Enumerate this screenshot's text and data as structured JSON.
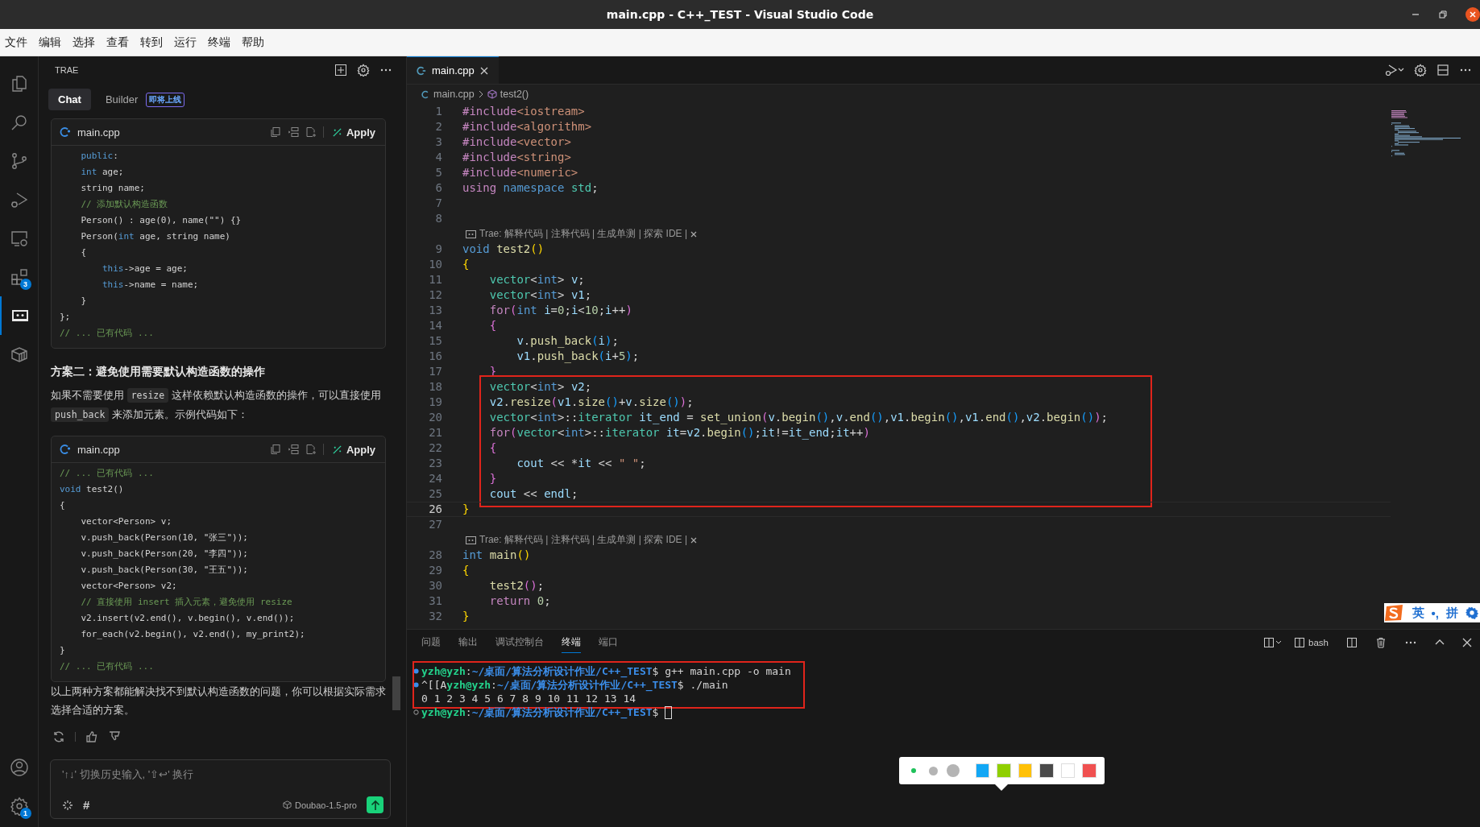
{
  "window": {
    "title": "main.cpp - C++_TEST - Visual Studio Code"
  },
  "menu": [
    "文件",
    "编辑",
    "选择",
    "查看",
    "转到",
    "运行",
    "终端",
    "帮助"
  ],
  "activity_bar": {
    "items": [
      {
        "kind": "files",
        "selected": false
      },
      {
        "kind": "search",
        "selected": false
      },
      {
        "kind": "source-control",
        "selected": false
      },
      {
        "kind": "run-debug",
        "selected": false
      },
      {
        "kind": "remote",
        "selected": false
      },
      {
        "kind": "extensions",
        "selected": false,
        "badge": "3"
      },
      {
        "kind": "chat",
        "selected": true
      },
      {
        "kind": "package",
        "selected": false
      }
    ],
    "bottom": [
      {
        "kind": "account"
      },
      {
        "kind": "settings",
        "badge": "1"
      }
    ]
  },
  "trae": {
    "title": "TRAE",
    "tabs": [
      {
        "label": "Chat",
        "selected": true
      },
      {
        "label": "Builder",
        "selected": false,
        "badge": "即将上线"
      }
    ],
    "messages": [
      {
        "kind": "code",
        "file": "main.cpp",
        "action": "Apply",
        "lines": [
          [
            {
              "kind": "keyword",
              "text": "    public"
            },
            {
              "kind": "plain",
              "text": ":"
            }
          ],
          [
            {
              "kind": "keyword",
              "text": "    int"
            },
            {
              "kind": "plain",
              "text": " age;"
            }
          ],
          [
            {
              "kind": "plain",
              "text": "    string name;"
            }
          ],
          [
            {
              "kind": "comment",
              "text": "    // 添加默认构造函数"
            }
          ],
          [
            {
              "kind": "plain",
              "text": "    Person() : age(0), name(\"\") {}"
            }
          ],
          [
            {
              "kind": "plain",
              "text": "    Person("
            },
            {
              "kind": "keyword",
              "text": "int"
            },
            {
              "kind": "plain",
              "text": " age, string name)"
            }
          ],
          [
            {
              "kind": "plain",
              "text": "    {"
            }
          ],
          [
            {
              "kind": "keyword",
              "text": "        this"
            },
            {
              "kind": "plain",
              "text": "->age = age;"
            }
          ],
          [
            {
              "kind": "keyword",
              "text": "        this"
            },
            {
              "kind": "plain",
              "text": "->name = name;"
            }
          ],
          [
            {
              "kind": "plain",
              "text": "    }"
            }
          ],
          [
            {
              "kind": "plain",
              "text": "};"
            }
          ],
          [
            {
              "kind": "comment",
              "text": "// ... 已有代码 ..."
            }
          ]
        ]
      },
      {
        "kind": "heading",
        "text": "方案二：避免使用需要默认构造函数的操作"
      },
      {
        "kind": "paragraph",
        "parts": [
          {
            "kind": "text",
            "text": "如果不需要使用 "
          },
          {
            "kind": "code",
            "text": "resize"
          },
          {
            "kind": "text",
            "text": " 这样依赖默认构造函数的操作，可以直接使用 "
          },
          {
            "kind": "code",
            "text": "push_back"
          },
          {
            "kind": "text",
            "text": " 来添加元素。示例代码如下："
          }
        ]
      },
      {
        "kind": "code",
        "file": "main.cpp",
        "action": "Apply",
        "lines": [
          [
            {
              "kind": "comment",
              "text": "// ... 已有代码 ..."
            }
          ],
          [
            {
              "kind": "keyword",
              "text": "void"
            },
            {
              "kind": "plain",
              "text": " test2()"
            }
          ],
          [
            {
              "kind": "plain",
              "text": "{"
            }
          ],
          [
            {
              "kind": "plain",
              "text": "    vector<Person> v;"
            }
          ],
          [
            {
              "kind": "plain",
              "text": "    v.push_back(Person(10, \"张三\"));"
            }
          ],
          [
            {
              "kind": "plain",
              "text": "    v.push_back(Person(20, \"李四\"));"
            }
          ],
          [
            {
              "kind": "plain",
              "text": "    v.push_back(Person(30, \"王五\"));"
            }
          ],
          [
            {
              "kind": "plain",
              "text": "    vector<Person> v2;"
            }
          ],
          [
            {
              "kind": "comment",
              "text": "    // 直接使用 insert 插入元素，避免使用 resize"
            }
          ],
          [
            {
              "kind": "plain",
              "text": "    v2.insert(v2.end(), v.begin(), v.end());"
            }
          ],
          [
            {
              "kind": "plain",
              "text": "    for_each(v2.begin(), v2.end(), my_print2);"
            }
          ],
          [
            {
              "kind": "plain",
              "text": "}"
            }
          ],
          [
            {
              "kind": "comment",
              "text": "// ... 已有代码 ..."
            }
          ]
        ]
      },
      {
        "kind": "paragraph",
        "parts": [
          {
            "kind": "text",
            "text": "以上两种方案都能解决找不到默认构造函数的问题，你可以根据实际需求选择合适的方案。"
          }
        ]
      }
    ],
    "input": {
      "placeholder": "'↑↓' 切换历史输入, '⇧↩' 换行",
      "hash": "#",
      "model": "Doubao-1.5-pro"
    }
  },
  "editor": {
    "tab": {
      "label": "main.cpp",
      "selected": true
    },
    "breadcrumb": [
      "main.cpp",
      "test2()"
    ],
    "blocks": [
      {
        "boxed": false,
        "rows": [
          {
            "kind": "code",
            "number": "1",
            "spans": [
              {
                "kind": "control",
                "text": "#include"
              },
              {
                "kind": "str",
                "text": "<iostream>"
              }
            ]
          },
          {
            "kind": "code",
            "number": "2",
            "spans": [
              {
                "kind": "control",
                "text": "#include"
              },
              {
                "kind": "str",
                "text": "<algorithm>"
              }
            ]
          },
          {
            "kind": "code",
            "number": "3",
            "spans": [
              {
                "kind": "control",
                "text": "#include"
              },
              {
                "kind": "str",
                "text": "<vector>"
              }
            ]
          },
          {
            "kind": "code",
            "number": "4",
            "spans": [
              {
                "kind": "control",
                "text": "#include"
              },
              {
                "kind": "str",
                "text": "<string>"
              }
            ]
          },
          {
            "kind": "code",
            "number": "5",
            "spans": [
              {
                "kind": "control",
                "text": "#include"
              },
              {
                "kind": "str",
                "text": "<numeric>"
              }
            ]
          },
          {
            "kind": "code",
            "number": "6",
            "spans": [
              {
                "kind": "control",
                "text": "using"
              },
              {
                "kind": "keyword",
                "text": " namespace"
              },
              {
                "kind": "type",
                "text": " std"
              },
              {
                "kind": "plain",
                "text": ";"
              }
            ]
          },
          {
            "kind": "code",
            "number": "7"
          },
          {
            "kind": "code",
            "number": "8"
          },
          {
            "kind": "lens",
            "text": "Trae: 解释代码 | 注释代码 | 生成单测 | 探索 IDE |"
          },
          {
            "kind": "code",
            "number": "9",
            "spans": [
              {
                "kind": "keyword",
                "text": "void"
              },
              {
                "kind": "func",
                "text": " test2"
              },
              {
                "kind": "b1",
                "text": "()"
              }
            ]
          },
          {
            "kind": "code",
            "number": "10",
            "spans": [
              {
                "kind": "b1",
                "text": "{"
              }
            ]
          },
          {
            "kind": "code",
            "number": "11",
            "spans": [
              {
                "kind": "type",
                "text": "    vector"
              },
              {
                "kind": "plain",
                "text": "<"
              },
              {
                "kind": "keyword",
                "text": "int"
              },
              {
                "kind": "plain",
                "text": "> "
              },
              {
                "kind": "var",
                "text": "v"
              },
              {
                "kind": "plain",
                "text": ";"
              }
            ]
          },
          {
            "kind": "code",
            "number": "12",
            "spans": [
              {
                "kind": "type",
                "text": "    vector"
              },
              {
                "kind": "plain",
                "text": "<"
              },
              {
                "kind": "keyword",
                "text": "int"
              },
              {
                "kind": "plain",
                "text": "> "
              },
              {
                "kind": "var",
                "text": "v1"
              },
              {
                "kind": "plain",
                "text": ";"
              }
            ]
          },
          {
            "kind": "code",
            "number": "13",
            "spans": [
              {
                "kind": "control",
                "text": "    for"
              },
              {
                "kind": "b2",
                "text": "("
              },
              {
                "kind": "keyword",
                "text": "int"
              },
              {
                "kind": "var",
                "text": " i"
              },
              {
                "kind": "plain",
                "text": "="
              },
              {
                "kind": "num",
                "text": "0"
              },
              {
                "kind": "plain",
                "text": ";"
              },
              {
                "kind": "var",
                "text": "i"
              },
              {
                "kind": "plain",
                "text": "<"
              },
              {
                "kind": "num",
                "text": "10"
              },
              {
                "kind": "plain",
                "text": ";"
              },
              {
                "kind": "var",
                "text": "i"
              },
              {
                "kind": "plain",
                "text": "++"
              },
              {
                "kind": "b2",
                "text": ")"
              }
            ]
          },
          {
            "kind": "code",
            "number": "14",
            "spans": [
              {
                "kind": "b2",
                "text": "    {"
              }
            ]
          },
          {
            "kind": "code",
            "number": "15",
            "spans": [
              {
                "kind": "var",
                "text": "        v"
              },
              {
                "kind": "plain",
                "text": "."
              },
              {
                "kind": "func",
                "text": "push_back"
              },
              {
                "kind": "b3",
                "text": "("
              },
              {
                "kind": "var",
                "text": "i"
              },
              {
                "kind": "b3",
                "text": ")"
              },
              {
                "kind": "plain",
                "text": ";"
              }
            ]
          },
          {
            "kind": "code",
            "number": "16",
            "spans": [
              {
                "kind": "var",
                "text": "        v1"
              },
              {
                "kind": "plain",
                "text": "."
              },
              {
                "kind": "func",
                "text": "push_back"
              },
              {
                "kind": "b3",
                "text": "("
              },
              {
                "kind": "var",
                "text": "i"
              },
              {
                "kind": "plain",
                "text": "+"
              },
              {
                "kind": "num",
                "text": "5"
              },
              {
                "kind": "b3",
                "text": ")"
              },
              {
                "kind": "plain",
                "text": ";"
              }
            ]
          },
          {
            "kind": "code",
            "number": "17",
            "spans": [
              {
                "kind": "b2",
                "text": "    }"
              }
            ]
          }
        ]
      },
      {
        "boxed": true,
        "rows": [
          {
            "kind": "code",
            "number": "18",
            "spans": [
              {
                "kind": "type",
                "text": "    vector"
              },
              {
                "kind": "plain",
                "text": "<"
              },
              {
                "kind": "keyword",
                "text": "int"
              },
              {
                "kind": "plain",
                "text": "> "
              },
              {
                "kind": "var",
                "text": "v2"
              },
              {
                "kind": "plain",
                "text": ";"
              }
            ]
          },
          {
            "kind": "code",
            "number": "19",
            "spans": [
              {
                "kind": "var",
                "text": "    v2"
              },
              {
                "kind": "plain",
                "text": "."
              },
              {
                "kind": "func",
                "text": "resize"
              },
              {
                "kind": "b2",
                "text": "("
              },
              {
                "kind": "var",
                "text": "v1"
              },
              {
                "kind": "plain",
                "text": "."
              },
              {
                "kind": "func",
                "text": "size"
              },
              {
                "kind": "b3",
                "text": "()"
              },
              {
                "kind": "plain",
                "text": "+"
              },
              {
                "kind": "var",
                "text": "v"
              },
              {
                "kind": "plain",
                "text": "."
              },
              {
                "kind": "func",
                "text": "size"
              },
              {
                "kind": "b3",
                "text": "()"
              },
              {
                "kind": "b2",
                "text": ")"
              },
              {
                "kind": "plain",
                "text": ";"
              }
            ]
          },
          {
            "kind": "code",
            "number": "20",
            "spans": [
              {
                "kind": "type",
                "text": "    vector"
              },
              {
                "kind": "plain",
                "text": "<"
              },
              {
                "kind": "keyword",
                "text": "int"
              },
              {
                "kind": "plain",
                "text": ">::"
              },
              {
                "kind": "type",
                "text": "iterator"
              },
              {
                "kind": "var",
                "text": " it_end"
              },
              {
                "kind": "plain",
                "text": " = "
              },
              {
                "kind": "func",
                "text": "set_union"
              },
              {
                "kind": "b2",
                "text": "("
              },
              {
                "kind": "var",
                "text": "v"
              },
              {
                "kind": "plain",
                "text": "."
              },
              {
                "kind": "func",
                "text": "begin"
              },
              {
                "kind": "b3",
                "text": "()"
              },
              {
                "kind": "plain",
                "text": ","
              },
              {
                "kind": "var",
                "text": "v"
              },
              {
                "kind": "plain",
                "text": "."
              },
              {
                "kind": "func",
                "text": "end"
              },
              {
                "kind": "b3",
                "text": "()"
              },
              {
                "kind": "plain",
                "text": ","
              },
              {
                "kind": "var",
                "text": "v1"
              },
              {
                "kind": "plain",
                "text": "."
              },
              {
                "kind": "func",
                "text": "begin"
              },
              {
                "kind": "b3",
                "text": "()"
              },
              {
                "kind": "plain",
                "text": ","
              },
              {
                "kind": "var",
                "text": "v1"
              },
              {
                "kind": "plain",
                "text": "."
              },
              {
                "kind": "func",
                "text": "end"
              },
              {
                "kind": "b3",
                "text": "()"
              },
              {
                "kind": "plain",
                "text": ","
              },
              {
                "kind": "var",
                "text": "v2"
              },
              {
                "kind": "plain",
                "text": "."
              },
              {
                "kind": "func",
                "text": "begin"
              },
              {
                "kind": "b3",
                "text": "()"
              },
              {
                "kind": "b2",
                "text": ")"
              },
              {
                "kind": "plain",
                "text": ";"
              }
            ]
          },
          {
            "kind": "code",
            "number": "21",
            "spans": [
              {
                "kind": "control",
                "text": "    for"
              },
              {
                "kind": "b2",
                "text": "("
              },
              {
                "kind": "type",
                "text": "vector"
              },
              {
                "kind": "plain",
                "text": "<"
              },
              {
                "kind": "keyword",
                "text": "int"
              },
              {
                "kind": "plain",
                "text": ">::"
              },
              {
                "kind": "type",
                "text": "iterator"
              },
              {
                "kind": "var",
                "text": " it"
              },
              {
                "kind": "plain",
                "text": "="
              },
              {
                "kind": "var",
                "text": "v2"
              },
              {
                "kind": "plain",
                "text": "."
              },
              {
                "kind": "func",
                "text": "begin"
              },
              {
                "kind": "b3",
                "text": "()"
              },
              {
                "kind": "plain",
                "text": ";"
              },
              {
                "kind": "var",
                "text": "it"
              },
              {
                "kind": "plain",
                "text": "!="
              },
              {
                "kind": "var",
                "text": "it_end"
              },
              {
                "kind": "plain",
                "text": ";"
              },
              {
                "kind": "var",
                "text": "it"
              },
              {
                "kind": "plain",
                "text": "++"
              },
              {
                "kind": "b2",
                "text": ")"
              }
            ]
          },
          {
            "kind": "code",
            "number": "22",
            "spans": [
              {
                "kind": "b2",
                "text": "    {"
              }
            ]
          },
          {
            "kind": "code",
            "number": "23",
            "spans": [
              {
                "kind": "var",
                "text": "        cout"
              },
              {
                "kind": "plain",
                "text": " << *"
              },
              {
                "kind": "var",
                "text": "it"
              },
              {
                "kind": "plain",
                "text": " << "
              },
              {
                "kind": "str",
                "text": "\" \""
              },
              {
                "kind": "plain",
                "text": ";"
              }
            ]
          },
          {
            "kind": "code",
            "number": "24",
            "spans": [
              {
                "kind": "b2",
                "text": "    }"
              }
            ]
          },
          {
            "kind": "code",
            "number": "25",
            "spans": [
              {
                "kind": "var",
                "text": "    cout"
              },
              {
                "kind": "plain",
                "text": " << "
              },
              {
                "kind": "var",
                "text": "endl"
              },
              {
                "kind": "plain",
                "text": ";"
              }
            ]
          }
        ]
      },
      {
        "boxed": false,
        "rows": [
          {
            "kind": "current",
            "number": "26",
            "spans": [
              {
                "kind": "b1",
                "text": "}"
              }
            ]
          },
          {
            "kind": "code",
            "number": "27"
          },
          {
            "kind": "lens",
            "text": "Trae: 解释代码 | 注释代码 | 生成单测 | 探索 IDE |"
          },
          {
            "kind": "code",
            "number": "28",
            "spans": [
              {
                "kind": "keyword",
                "text": "int"
              },
              {
                "kind": "func",
                "text": " main"
              },
              {
                "kind": "b1",
                "text": "()"
              }
            ]
          },
          {
            "kind": "code",
            "number": "29",
            "spans": [
              {
                "kind": "b1",
                "text": "{"
              }
            ]
          },
          {
            "kind": "code",
            "number": "30",
            "spans": [
              {
                "kind": "func",
                "text": "    test2"
              },
              {
                "kind": "b2",
                "text": "()"
              },
              {
                "kind": "plain",
                "text": ";"
              }
            ]
          },
          {
            "kind": "code",
            "number": "31",
            "spans": [
              {
                "kind": "control",
                "text": "    return"
              },
              {
                "kind": "num",
                "text": " 0"
              },
              {
                "kind": "plain",
                "text": ";"
              }
            ]
          },
          {
            "kind": "code",
            "number": "32",
            "spans": [
              {
                "kind": "b1",
                "text": "}"
              }
            ]
          }
        ]
      }
    ]
  },
  "panel": {
    "tabs": [
      {
        "label": "问题",
        "selected": false
      },
      {
        "label": "输出",
        "selected": false
      },
      {
        "label": "调试控制台",
        "selected": false
      },
      {
        "label": "终端",
        "selected": true
      },
      {
        "label": "端口",
        "selected": false
      }
    ],
    "shell": "bash",
    "groups": [
      {
        "boxed": true,
        "lines": [
          {
            "kind": "command",
            "spans": [
              {
                "kind": "user",
                "text": "yzh@yzh"
              },
              {
                "kind": "plain",
                "text": ":"
              },
              {
                "kind": "path",
                "text": "~/桌面/算法分析设计作业/C++_TEST"
              },
              {
                "kind": "plain",
                "text": "$ g++ main.cpp -o main"
              }
            ]
          },
          {
            "kind": "command",
            "spans": [
              {
                "kind": "plain",
                "text": "^[[A"
              },
              {
                "kind": "user",
                "text": "yzh@yzh"
              },
              {
                "kind": "plain",
                "text": ":"
              },
              {
                "kind": "path",
                "text": "~/桌面/算法分析设计作业/C++_TEST"
              },
              {
                "kind": "plain",
                "text": "$ ./main"
              }
            ]
          },
          {
            "kind": "output",
            "spans": [
              {
                "kind": "plain",
                "text": "0 1 2 3 4 5 6 7 8 9 10 11 12 13 14"
              }
            ]
          }
        ]
      },
      {
        "boxed": false,
        "lines": [
          {
            "kind": "prompt",
            "spans": [
              {
                "kind": "user",
                "text": "yzh@yzh"
              },
              {
                "kind": "plain",
                "text": ":"
              },
              {
                "kind": "path",
                "text": "~/桌面/算法分析设计作业/C++_TEST"
              },
              {
                "kind": "plain",
                "text": "$"
              }
            ]
          }
        ]
      }
    ]
  },
  "color_picker": {
    "sizes": [
      {
        "kind": "small",
        "color": "#1ec15a"
      },
      {
        "kind": "medium",
        "color": "#b4b4b4"
      },
      {
        "kind": "large",
        "color": "#b4b4b4"
      }
    ],
    "swatches": [
      {
        "color": "#12a7f5"
      },
      {
        "color": "#8fcf00"
      },
      {
        "color": "#ffc107"
      },
      {
        "color": "#4a4a4a"
      },
      {
        "color": "#ffffff"
      },
      {
        "color": "#f05050"
      }
    ]
  },
  "ime": {
    "mode": "英",
    "punctuation": "•,",
    "layout": "拼"
  }
}
